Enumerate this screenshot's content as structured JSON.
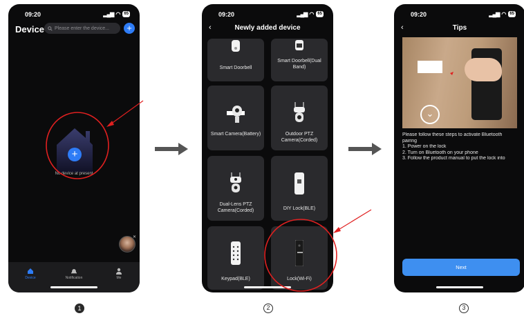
{
  "status": {
    "time": "09:20",
    "battery": "65"
  },
  "screen1": {
    "title": "Device",
    "search_placeholder": "Please enter the device...",
    "empty_text": "No device at present",
    "tabs": [
      {
        "label": "Device"
      },
      {
        "label": "Notification"
      },
      {
        "label": "Me"
      }
    ]
  },
  "screen2": {
    "title": "Newly added device",
    "cards": [
      {
        "label": "Smart Doorbell"
      },
      {
        "label": "Smart Doorbell(Dual Band)"
      },
      {
        "label": "Smart Camera(Battery)"
      },
      {
        "label": "Outdoor PTZ Camera(Corded)"
      },
      {
        "label": "Dual-Lens PTZ Camera(Corded)"
      },
      {
        "label": "DIY Lock(BLE)"
      },
      {
        "label": "Keypad(BLE)"
      },
      {
        "label": "Lock(Wi-Fi)"
      }
    ]
  },
  "screen3": {
    "title": "Tips",
    "instructions": [
      "Please follow these steps to activate Bluetooth",
      "pairing",
      "1. Power on the lock",
      "2. Turn on Bluetooth on your phone",
      "3. Follow the product manual to put the lock into"
    ],
    "next_label": "Next"
  },
  "steps": [
    "1",
    "2",
    "3"
  ],
  "colors": {
    "accent": "#2e7cf6",
    "annotation": "#e02020",
    "next_button": "#3e8ff0"
  }
}
